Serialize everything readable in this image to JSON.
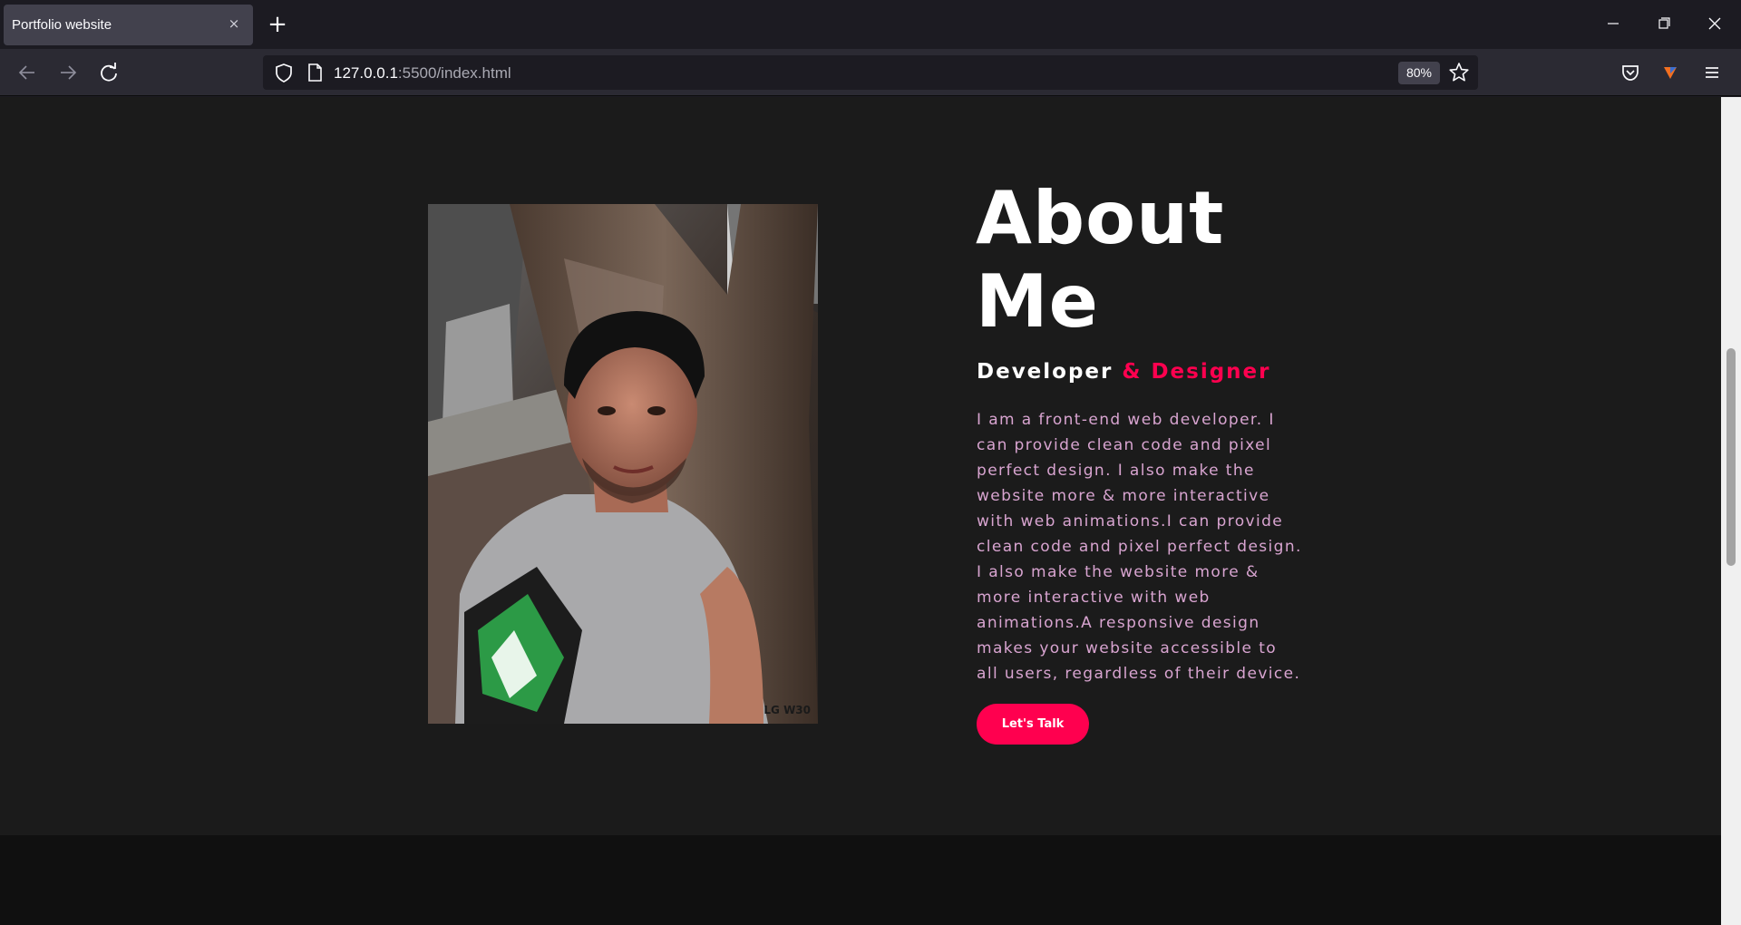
{
  "browser": {
    "tab_title": "Portfolio website",
    "tab_close_glyph": "×",
    "new_tab_glyph": "+",
    "url_host": "127.0.0.1",
    "url_rest": ":5500/index.html",
    "zoom": "80%",
    "icons": [
      "back-arrow-icon",
      "forward-arrow-icon",
      "reload-icon",
      "shield-icon",
      "page-icon",
      "star-icon",
      "pocket-icon",
      "extension-icon",
      "hamburger-menu-icon",
      "minimize-icon",
      "restore-icon",
      "close-icon"
    ]
  },
  "about": {
    "title_line1": "About",
    "title_line2": "Me",
    "subtitle_main": "Developer",
    "subtitle_accent": "& Designer",
    "paragraph": "I am a front-end web developer. I can provide clean code and pixel perfect design. I also make the website more & more interactive with web animations.I can provide clean code and pixel perfect design. I also make the website more & more interactive with web animations.A responsive design makes your website accessible to all users, regardless of their device.",
    "button_label": "Let's Talk",
    "photo_watermark": "LG W30"
  },
  "colors": {
    "accent": "#ff004f",
    "paragraph": "#d8a4d0",
    "section_bg": "#1b1b1b",
    "chrome_bg": "#1c1b22",
    "toolbar_bg": "#2b2a33"
  }
}
